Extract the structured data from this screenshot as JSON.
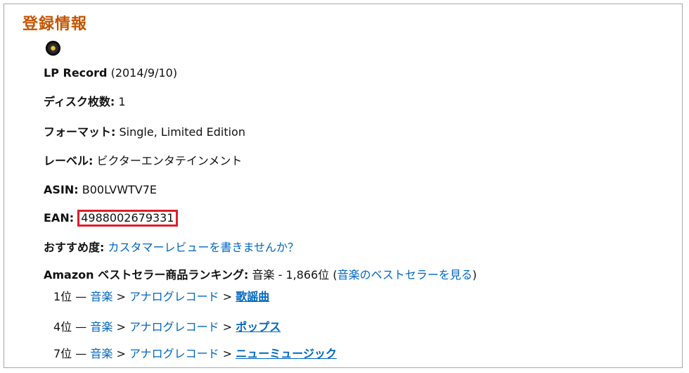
{
  "section_title": "登録情報",
  "media": {
    "icon": "vinyl-record-icon",
    "format_name": "LP Record",
    "release_date": "(2014/9/10)"
  },
  "discs": {
    "label": "ディスク枚数:",
    "value": "1"
  },
  "format": {
    "label": "フォーマット:",
    "value": "Single, Limited Edition"
  },
  "label_info": {
    "label": "レーベル:",
    "value": "ビクターエンタテインメント"
  },
  "asin": {
    "label": "ASIN:",
    "value": "B00LVWTV7E"
  },
  "ean": {
    "label": "EAN:",
    "value": "4988002679331",
    "highlight_color": "#e01e2a"
  },
  "review": {
    "label": "おすすめ度:",
    "link": "カスタマーレビューを書きませんか？"
  },
  "ranking": {
    "label": "Amazon ベストセラー商品ランキング:",
    "category": "音楽",
    "dash": "-",
    "rank": "1,866位",
    "paren_open": "(",
    "link": "音楽のベストセラーを見る",
    "paren_close": ")",
    "sub": [
      {
        "rank": "1位",
        "dash": "—",
        "cat": "音楽",
        "sep1": ">",
        "sub1": "アナログレコード",
        "sep2": ">",
        "leaf": "歌謡曲"
      },
      {
        "rank": "4位",
        "dash": "—",
        "cat": "音楽",
        "sep1": ">",
        "sub1": "アナログレコード",
        "sep2": ">",
        "leaf": "ポップス"
      },
      {
        "rank": "7位",
        "dash": "—",
        "cat": "音楽",
        "sep1": ">",
        "sub1": "アナログレコード",
        "sep2": ">",
        "leaf": "ニューミュージック"
      }
    ]
  },
  "colors": {
    "title": "#c45500",
    "link": "#0066c0",
    "border": "#a8a8a8"
  }
}
